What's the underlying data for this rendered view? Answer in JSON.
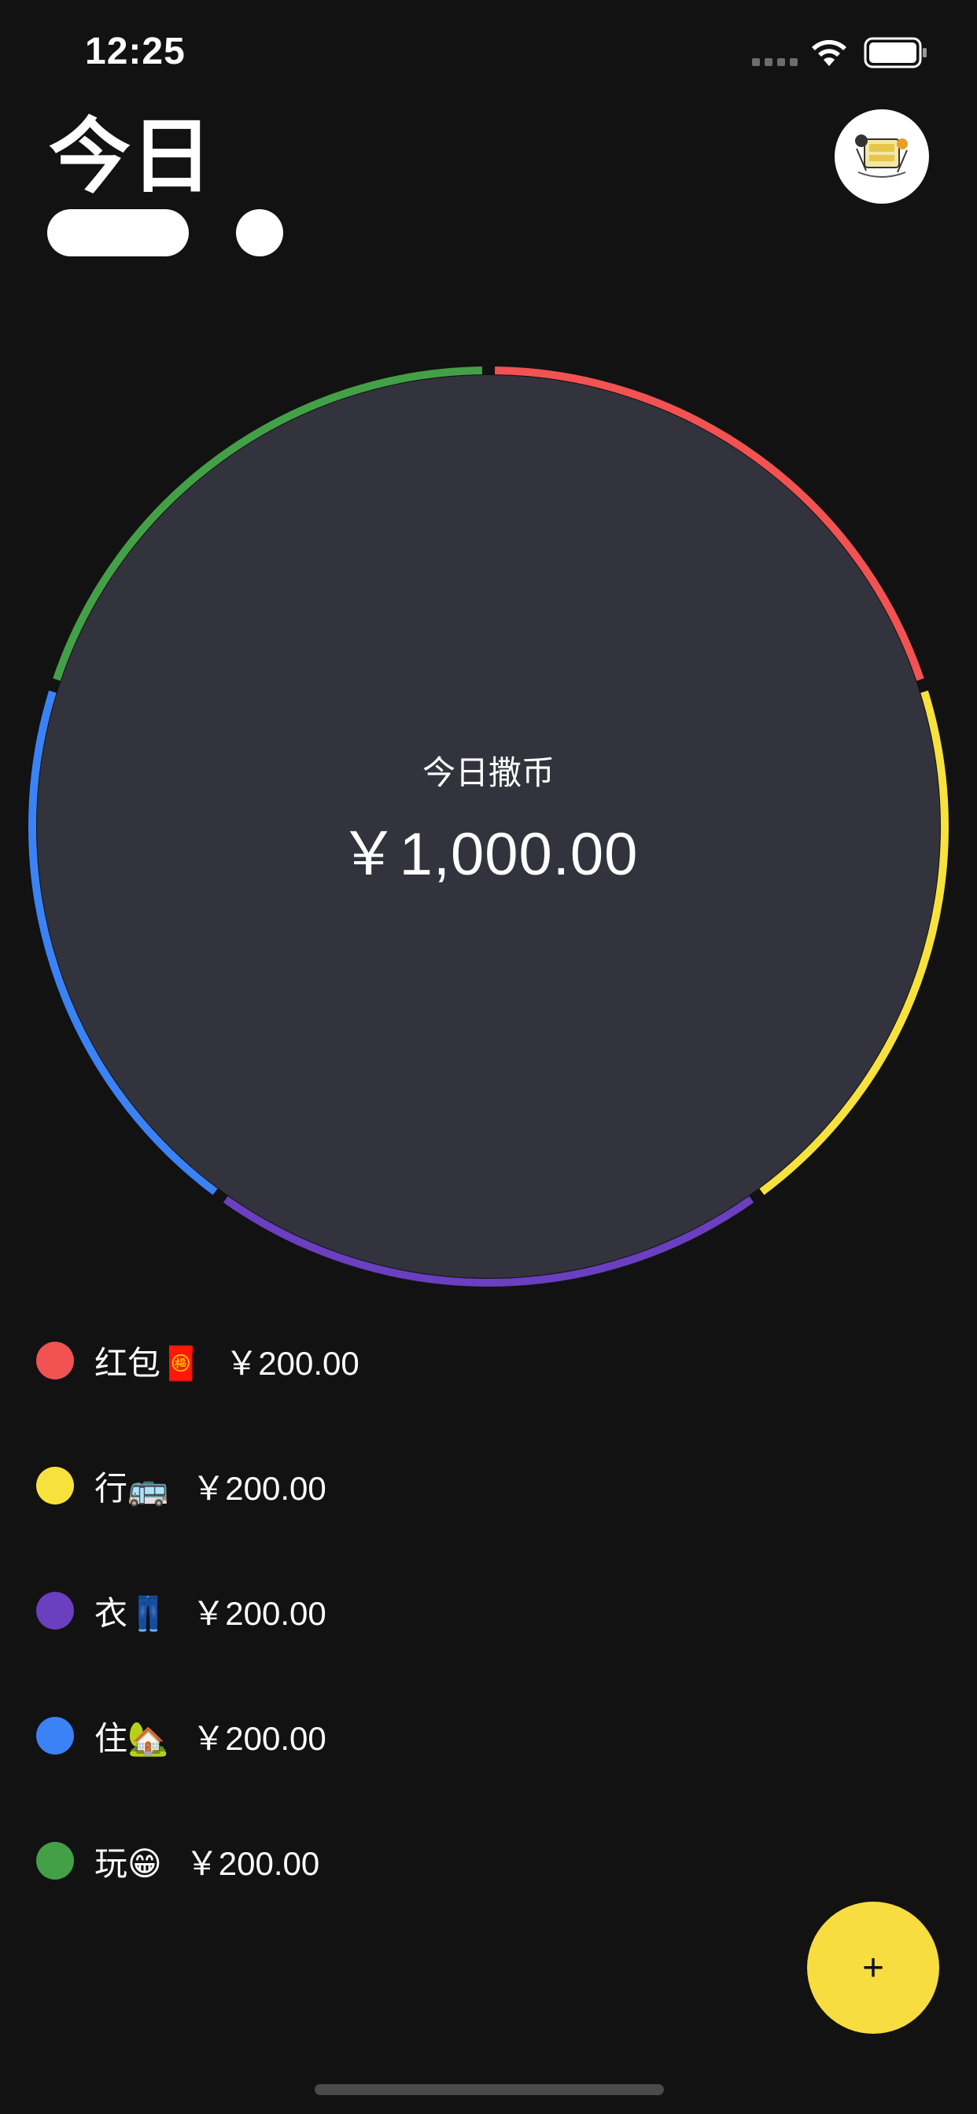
{
  "status_bar": {
    "time": "12:25"
  },
  "header": {
    "title": "今日"
  },
  "summary": {
    "label": "今日撒币",
    "amount": "￥1,000.00"
  },
  "categories": [
    {
      "label": "红包🧧",
      "amount": "￥200.00",
      "color": "#f25252"
    },
    {
      "label": "行🚌",
      "amount": "￥200.00",
      "color": "#f7e23d"
    },
    {
      "label": "衣👖",
      "amount": "￥200.00",
      "color": "#6a3fc0"
    },
    {
      "label": "住🏡",
      "amount": "￥200.00",
      "color": "#3b82f6"
    },
    {
      "label": "玩😁",
      "amount": "￥200.00",
      "color": "#43a047"
    }
  ],
  "chart_data": {
    "type": "pie",
    "style": "ring",
    "categories": [
      "红包🧧",
      "行🚌",
      "衣👖",
      "住🏡",
      "玩😁"
    ],
    "values": [
      200,
      200,
      200,
      200,
      200
    ],
    "colors": [
      "#f25252",
      "#f7e23d",
      "#6a3fc0",
      "#3b82f6",
      "#43a047"
    ],
    "center_fill": "#33333d"
  },
  "fab": {
    "label": "+"
  },
  "colors": {
    "background": "#121212",
    "accent": "#f7dd3f"
  }
}
